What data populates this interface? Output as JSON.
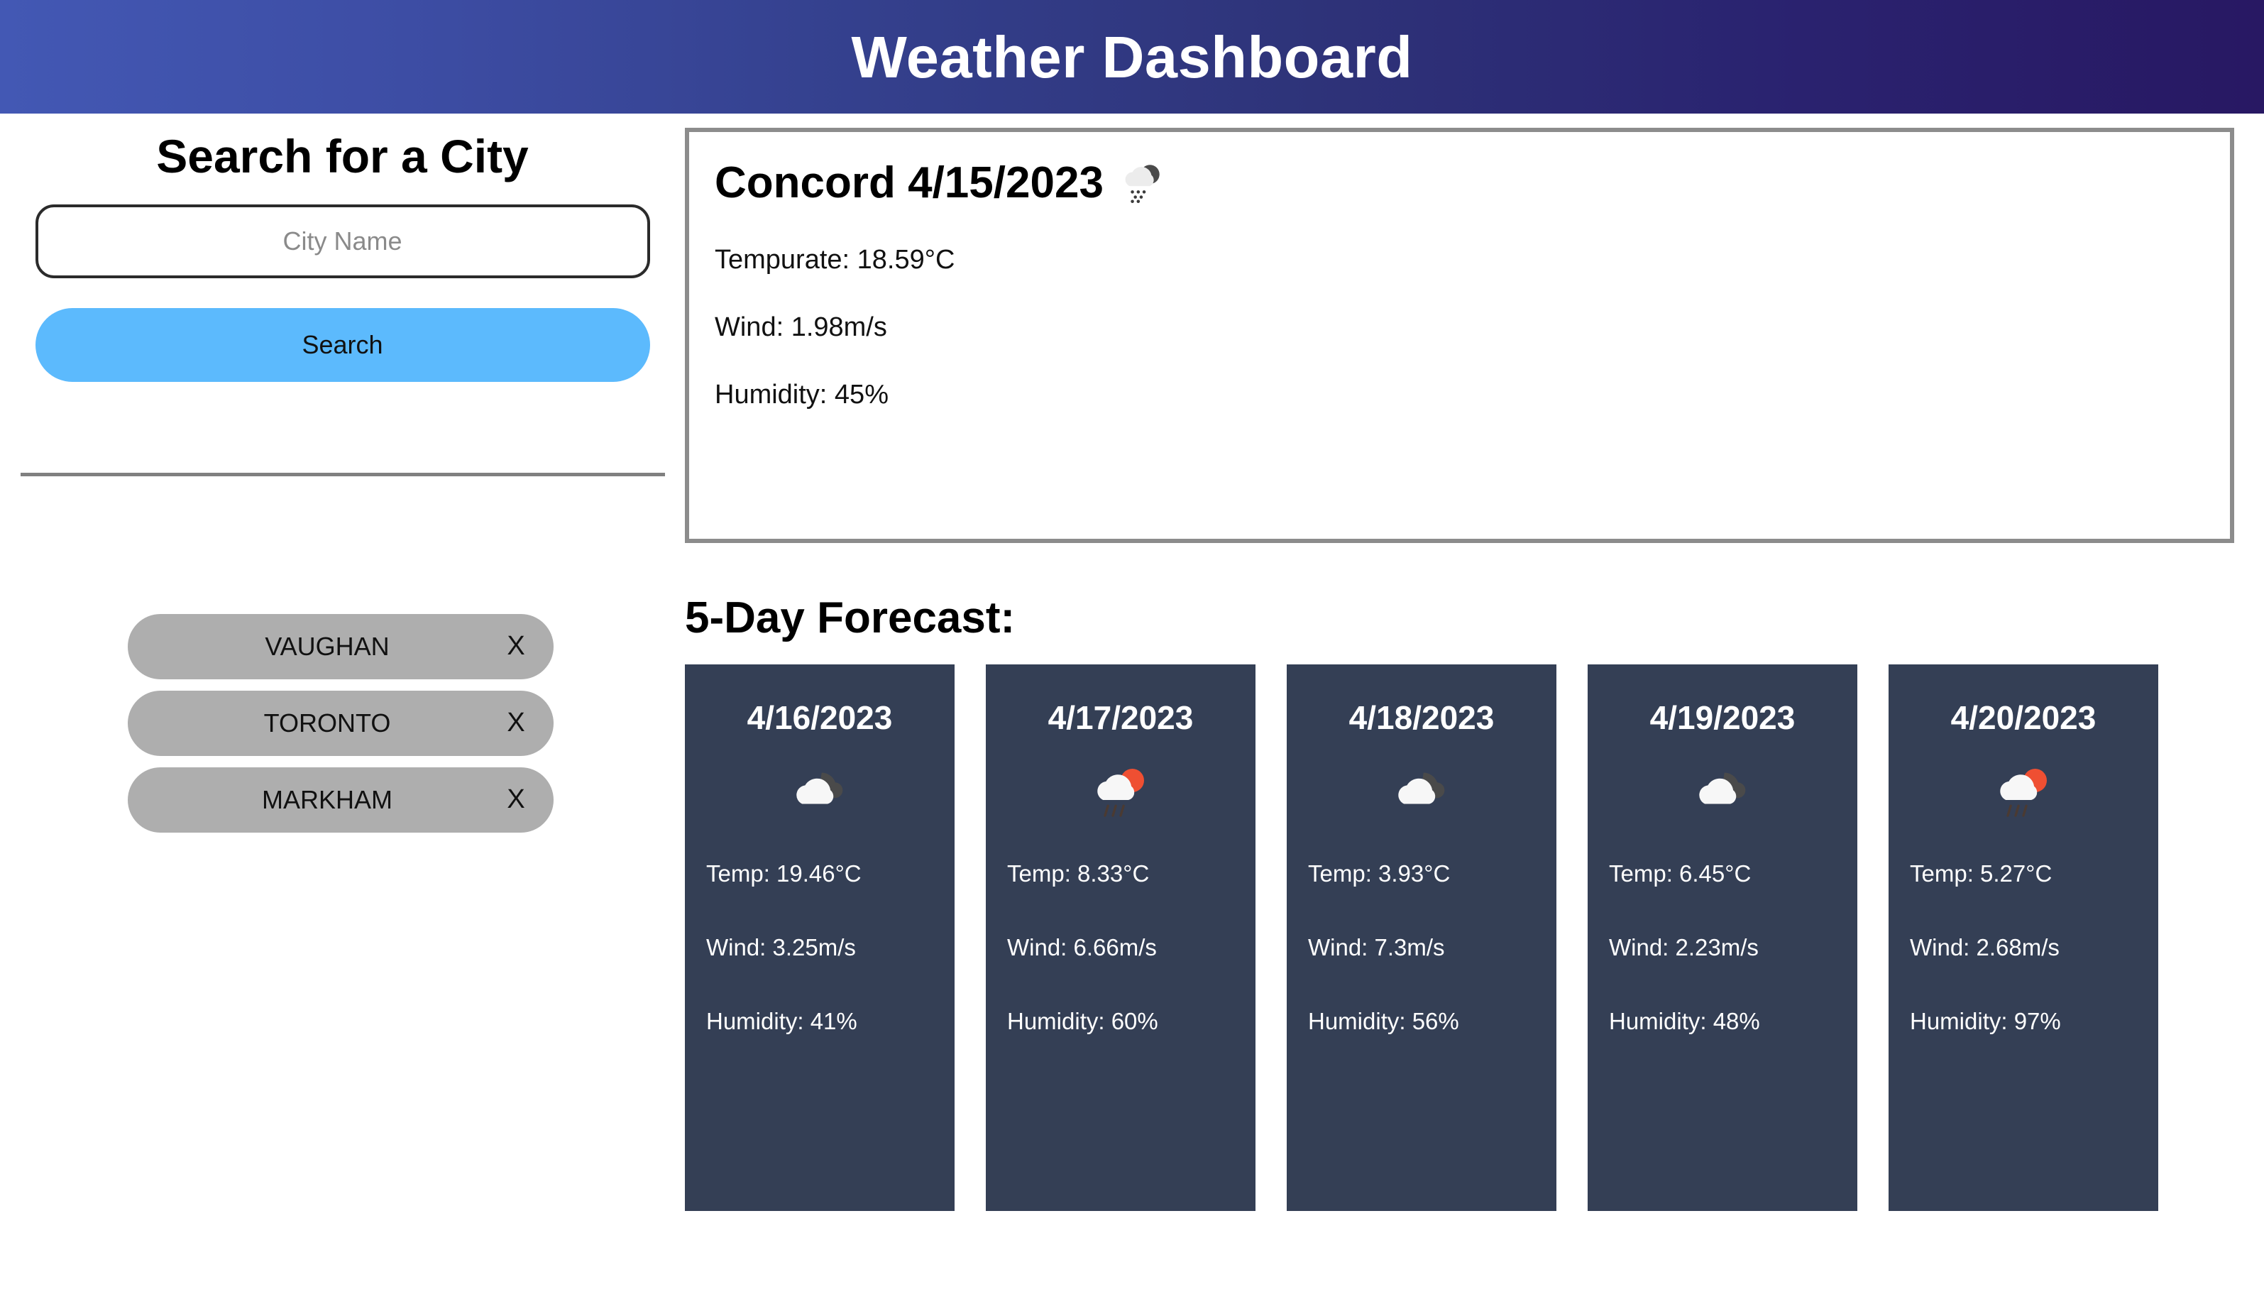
{
  "header": {
    "title": "Weather Dashboard",
    "gradient_start": "#4358b4",
    "gradient_end": "#281863"
  },
  "sidebar": {
    "title": "Search for a City",
    "search_input": {
      "value": "",
      "placeholder": "City Name"
    },
    "search_button_label": "Search",
    "search_button_color": "#5cbafd",
    "history_pill_color": "#aeaeae",
    "delete_label": "X",
    "history": [
      {
        "city": "VAUGHAN"
      },
      {
        "city": "TORONTO"
      },
      {
        "city": "MARKHAM"
      }
    ]
  },
  "current": {
    "city": "Concord",
    "date": "4/15/2023",
    "heading": "Concord 4/15/2023",
    "icon": "rain-cloud-icon",
    "temperature": "Tempurate: 18.59°C",
    "wind": "Wind: 1.98m/s",
    "humidity": "Humidity: 45%",
    "border_color": "#8c8c8c"
  },
  "forecast": {
    "heading": "5-Day Forecast:",
    "card_color": "#343f55",
    "cards": [
      {
        "date": "4/16/2023",
        "icon": "cloudy-icon",
        "temp": "Temp: 19.46°C",
        "wind": "Wind: 3.25m/s",
        "humidity": "Humidity: 41%"
      },
      {
        "date": "4/17/2023",
        "icon": "sun-rain-cloud-icon",
        "temp": "Temp: 8.33°C",
        "wind": "Wind: 6.66m/s",
        "humidity": "Humidity: 60%"
      },
      {
        "date": "4/18/2023",
        "icon": "cloudy-icon",
        "temp": "Temp: 3.93°C",
        "wind": "Wind: 7.3m/s",
        "humidity": "Humidity: 56%"
      },
      {
        "date": "4/19/2023",
        "icon": "cloudy-icon",
        "temp": "Temp: 6.45°C",
        "wind": "Wind: 2.23m/s",
        "humidity": "Humidity: 48%"
      },
      {
        "date": "4/20/2023",
        "icon": "sun-rain-cloud-icon",
        "temp": "Temp: 5.27°C",
        "wind": "Wind: 2.68m/s",
        "humidity": "Humidity: 97%"
      }
    ]
  }
}
